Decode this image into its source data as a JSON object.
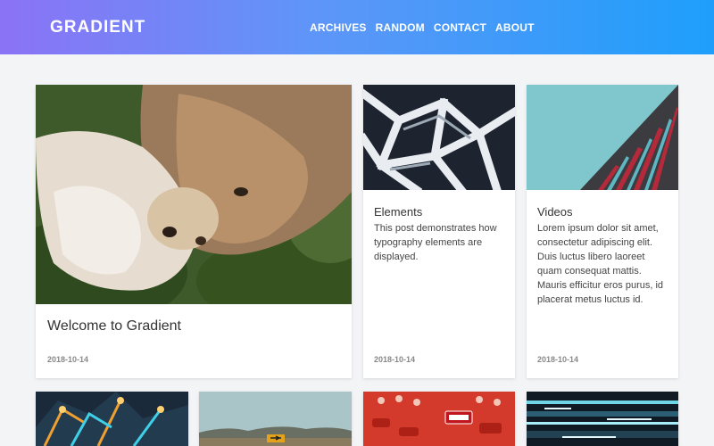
{
  "header": {
    "logo": "GRADIENT",
    "nav": [
      "ARCHIVES",
      "RANDOM",
      "CONTACT",
      "ABOUT"
    ]
  },
  "posts": [
    {
      "title": "Welcome to Gradient",
      "excerpt": "",
      "date": "2018-10-14",
      "image": "cat-and-dog-on-grass-photo"
    },
    {
      "title": "Elements",
      "excerpt": "This post demonstrates how typography elements are displayed.",
      "date": "2018-10-14",
      "image": "white-geometric-structure-photo"
    },
    {
      "title": "Videos",
      "excerpt": "Lorem ipsum dolor sit amet, consectetur adipiscing elit. Duis luctus libero laoreet quam consequat mattis. Mauris efficitur eros purus, id placerat metus luctus id.",
      "date": "2018-10-14",
      "image": "building-facade-photo"
    }
  ],
  "colors": {
    "header_start": "#8b73f5",
    "header_end": "#1e9ffb",
    "background": "#f3f4f6"
  }
}
